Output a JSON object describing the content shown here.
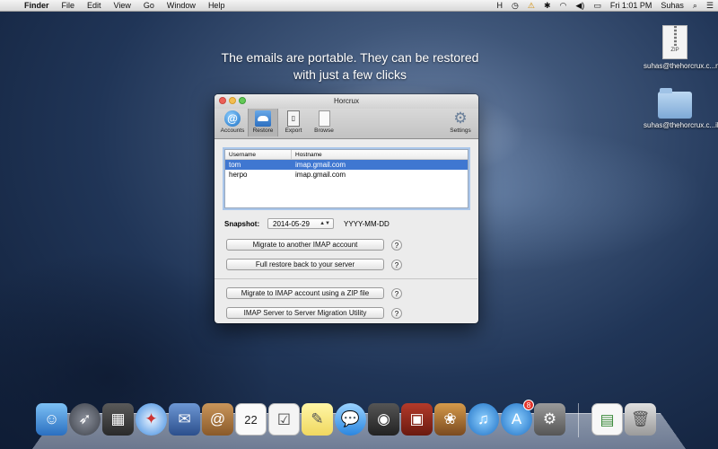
{
  "menubar": {
    "app_name": "Finder",
    "menus": [
      "File",
      "Edit",
      "View",
      "Go",
      "Window",
      "Help"
    ],
    "input_indicator": "H",
    "clock": "Fri 1:01 PM",
    "user": "Suhas"
  },
  "headline": "The emails are portable. They can be restored with just a few clicks",
  "desktop": {
    "zip_icon_text": "ZIP",
    "zip_label": "suhas@thehorcrux.c...m.zip",
    "folder_label": "suhas@thehorcrux.c...il.com"
  },
  "window": {
    "title": "Horcrux",
    "toolbar": {
      "accounts": "Accounts",
      "restore": "Restore",
      "export": "Export",
      "browse": "Browse",
      "settings": "Settings"
    },
    "table": {
      "headers": [
        "Username",
        "Hostname"
      ],
      "rows": [
        {
          "username": "tom",
          "hostname": "imap.gmail.com"
        },
        {
          "username": "herpo",
          "hostname": "imap.gmail.com"
        }
      ]
    },
    "snapshot": {
      "label": "Snapshot:",
      "date": "2014-05-29",
      "format": "YYYY-MM-DD"
    },
    "buttons": {
      "migrate_imap": "Migrate to another IMAP account",
      "full_restore": "Full restore back to your server",
      "migrate_zip": "Migrate to IMAP account using a ZIP file",
      "server_migration": "IMAP Server to Server Migration Utility",
      "help": "?"
    }
  },
  "dock": {
    "calendar_day": "22",
    "app_store_badge": "8"
  }
}
